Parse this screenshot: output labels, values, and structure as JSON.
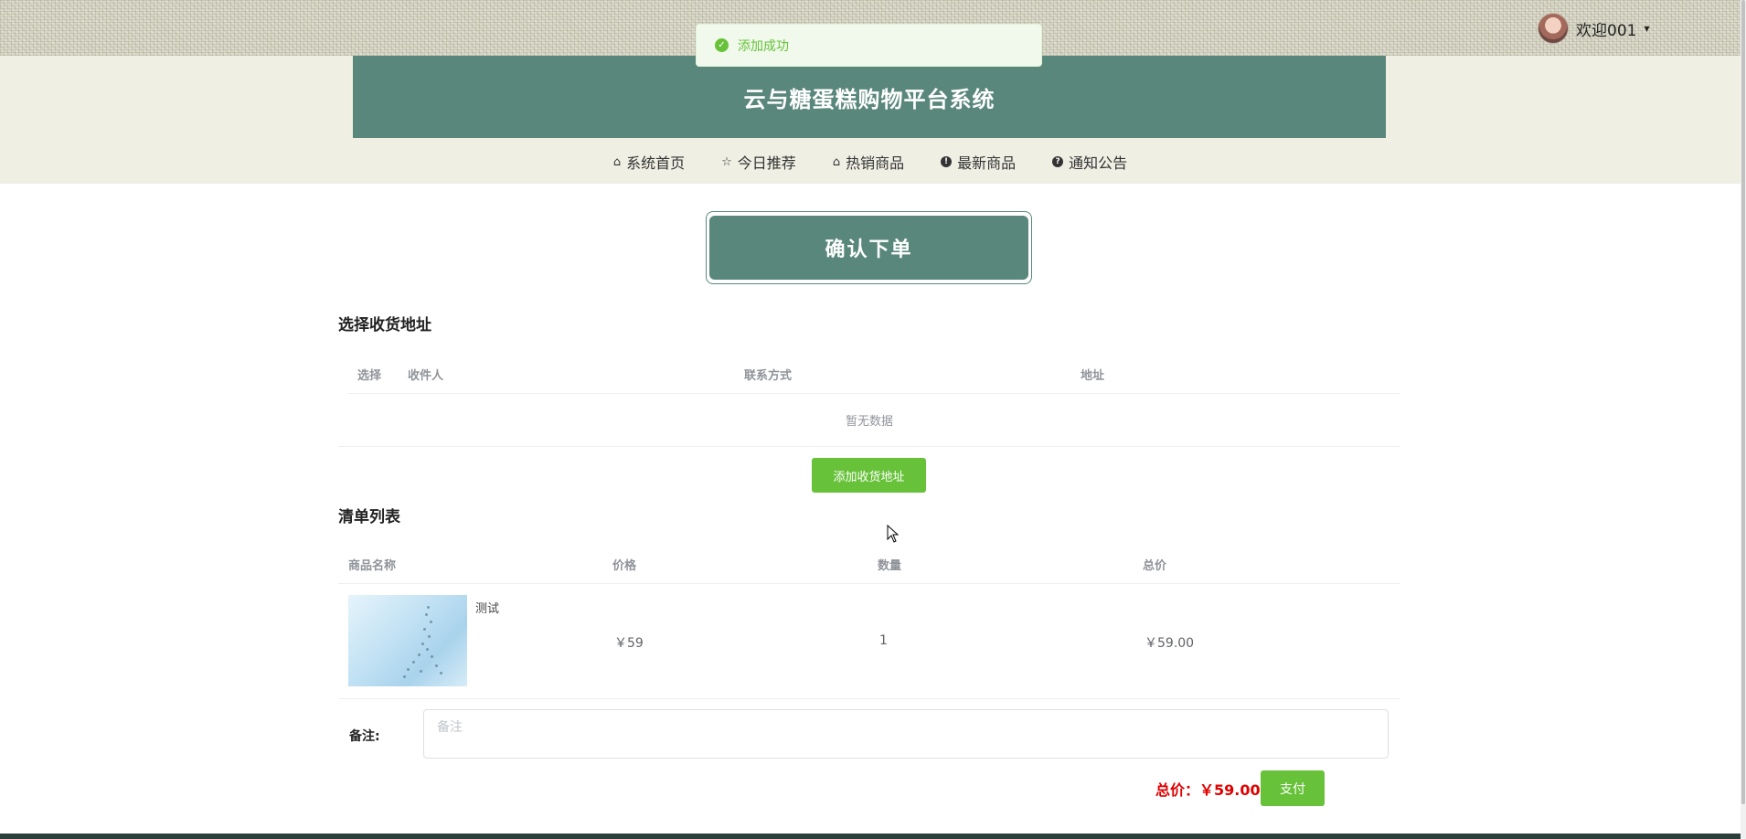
{
  "user": {
    "greeting": "欢迎001",
    "caret": "▾"
  },
  "toast": {
    "icon": "✓",
    "message": "添加成功"
  },
  "header": {
    "title": "云与糖蛋糕购物平台系统"
  },
  "nav": {
    "items": [
      {
        "label": "系统首页",
        "icon": "⌂"
      },
      {
        "label": "今日推荐",
        "icon": "☆"
      },
      {
        "label": "热销商品",
        "icon": "⌂"
      },
      {
        "label": "最新商品",
        "icon": "!"
      },
      {
        "label": "通知公告",
        "icon": "?"
      }
    ]
  },
  "confirm": {
    "title": "确认下单"
  },
  "address": {
    "section_title": "选择收货地址",
    "columns": [
      "选择",
      "收件人",
      "联系方式",
      "地址"
    ],
    "empty_text": "暂无数据",
    "add_button": "添加收货地址"
  },
  "items": {
    "section_title": "清单列表",
    "columns": [
      "商品名称",
      "价格",
      "数量",
      "总价"
    ],
    "rows": [
      {
        "name": "测试",
        "price": "￥59",
        "quantity": "1",
        "subtotal": "￥59.00"
      }
    ]
  },
  "remark": {
    "label": "备注:",
    "placeholder": "备注",
    "value": ""
  },
  "summary": {
    "total": "总价：￥59.00",
    "pay_button": "支付"
  },
  "colors": {
    "primary": "#5a877b",
    "success": "#67c23a",
    "price": "#e00000"
  }
}
